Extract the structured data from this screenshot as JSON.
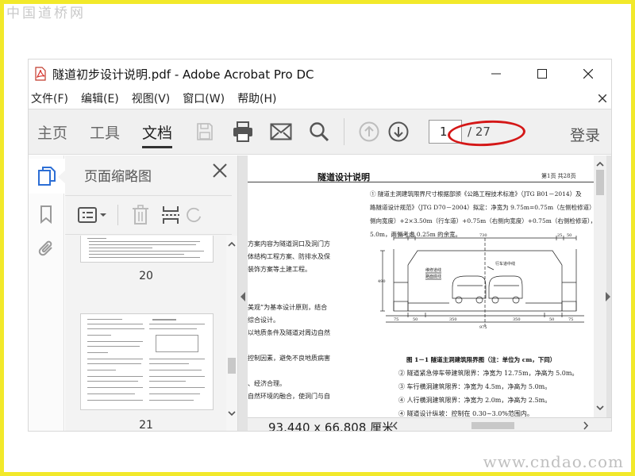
{
  "watermark": {
    "top": "中国道桥网",
    "bottom": "www.cndao.com"
  },
  "window": {
    "title": "隧道初步设计说明.pdf - Adobe Acrobat Pro DC"
  },
  "menu": {
    "items": [
      "文件(F)",
      "编辑(E)",
      "视图(V)",
      "窗口(W)",
      "帮助(H)"
    ]
  },
  "toolbar": {
    "tabs": [
      "主页",
      "工具",
      "文档"
    ],
    "active_tab": "文档",
    "page_current": "1",
    "page_total": "/ 27",
    "login": "登录"
  },
  "panel": {
    "title": "页面缩略图",
    "thumbnails": [
      {
        "label": "20"
      },
      {
        "label": "21"
      }
    ]
  },
  "document": {
    "page_title": "隧道设计说明",
    "page_number": "第1页  共28页",
    "left_column": [
      "方案内容为隧道洞口及洞门方",
      "体结构工程方案、防排水及保",
      "装饰方案等土建工程。",
      "",
      "",
      "美观”为基本设计原则，结合",
      "综合设计。",
      "以地质条件及隧道对周边自然",
      "",
      "控制因素，避免不良地质病害",
      "",
      "、经济合理。",
      "自然环境的融合，使洞门与自"
    ],
    "right_lines": [
      "① 隧道主洞建筑限界尺寸根据部颁《公路工程技术标准》（JTG B01－2014）及",
      "路隧道设计规范》（JTG D70－2004）拟定：净宽为 9.75m=0.75m（左侧检修道）+0.50m",
      "侧向宽度）+2×3.50m（行车道）+0.75m（右侧向宽度）+0.75m（右侧检修道），净",
      "5.0m，两侧考虑 0.25m 的余宽。"
    ],
    "figure": {
      "dims_top": [
        "50",
        "25",
        "730",
        "25",
        "50"
      ],
      "dims_bottom": [
        "75",
        "50",
        "350",
        "350",
        "50",
        "75"
      ],
      "dim_total": "975",
      "left_vertical": "490",
      "label_center": "行车道中线",
      "label_maint": "维修道线",
      "label_road": "路面底线",
      "caption": "图 1－1    隧道主洞建筑限界图（注：单位为 cm，下同）"
    },
    "notes": [
      "② 隧道紧急停车带建筑限界：净宽为 12.75m，净高为 5.0m。",
      "③ 车行横洞建筑限界：净宽为 4.5m，净高为 5.0m。",
      "④ 人行横洞建筑限界：净宽为 2.0m，净高为 2.5m。",
      "④ 隧道设计纵坡：控制在 0.30~3.0%范围内。"
    ]
  },
  "status": {
    "page_size": "93.440 x 66.808 厘米"
  },
  "colors": {
    "annotation_oval": "#d41717",
    "frame": "#f2e92a",
    "active_icon": "#2c6ed5"
  }
}
